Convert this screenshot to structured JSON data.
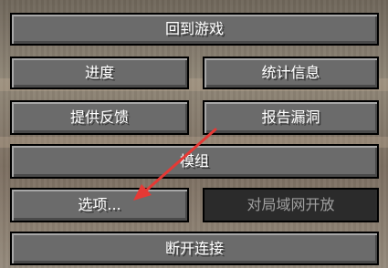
{
  "menu": {
    "back_to_game": "回到游戏",
    "advancements": "进度",
    "statistics": "统计信息",
    "give_feedback": "提供反馈",
    "report_bugs": "报告漏洞",
    "mods": "模组",
    "options": "选项...",
    "open_to_lan": "对局域网开放",
    "disconnect": "断开连接"
  },
  "annotation": {
    "arrow_color": "#e53935"
  },
  "colors": {
    "button_face": "#6b6b6b",
    "button_disabled": "#2b2b2b",
    "button_text": "#ffffff",
    "disabled_text": "#a0a0a0"
  }
}
